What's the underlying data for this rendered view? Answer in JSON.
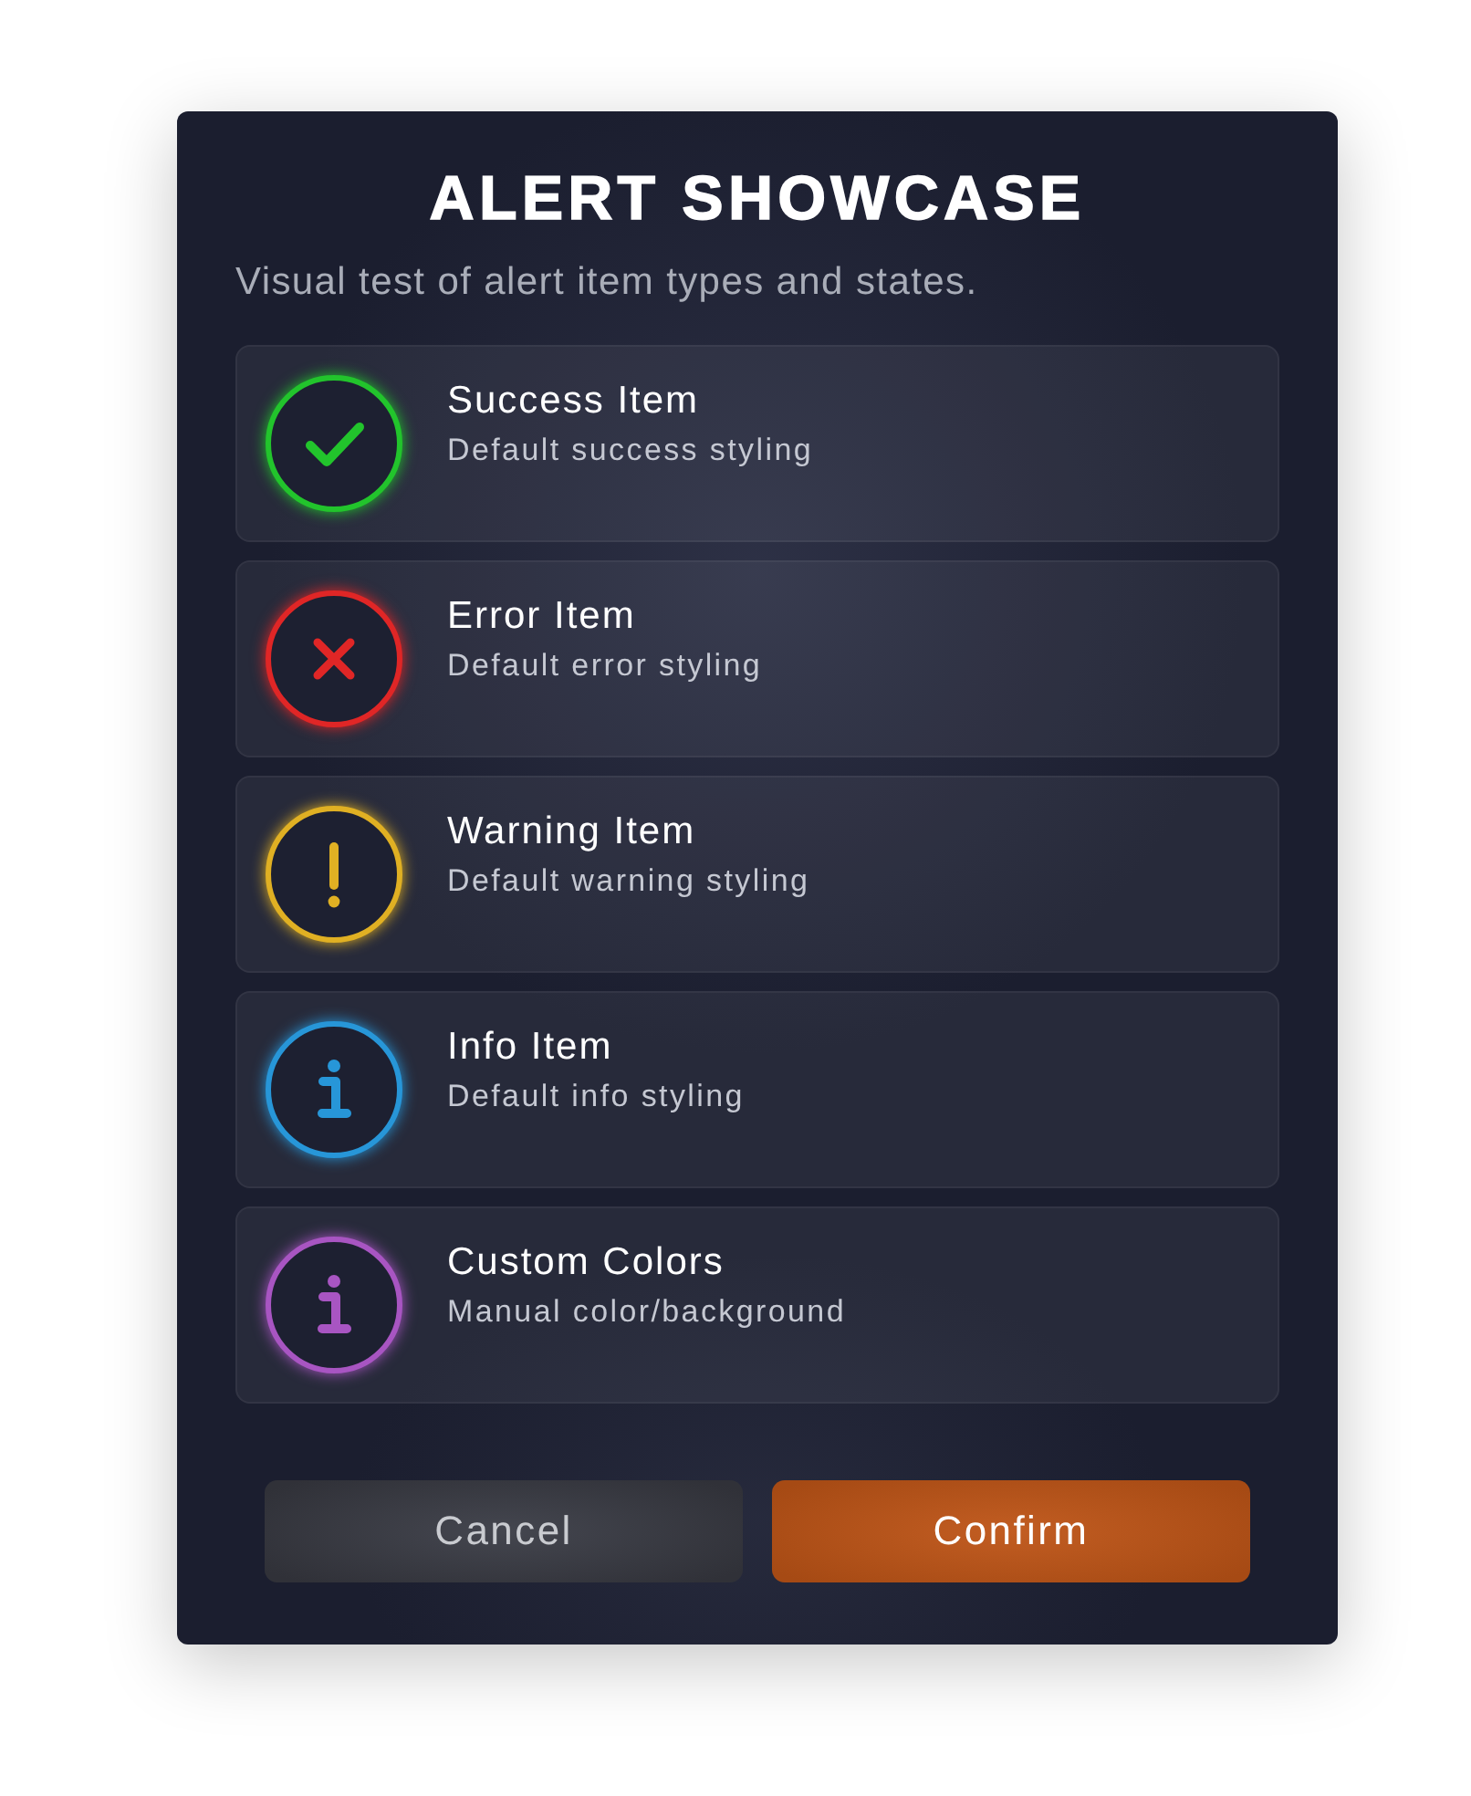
{
  "dialog": {
    "title": "ALERT SHOWCASE",
    "subtitle": "Visual test of alert item types and states."
  },
  "items": [
    {
      "kind": "success",
      "color": "#22c42c",
      "title": "Success Item",
      "description": "Default success styling"
    },
    {
      "kind": "error",
      "color": "#e02626",
      "title": "Error Item",
      "description": "Default error styling"
    },
    {
      "kind": "warning",
      "color": "#e0b023",
      "title": "Warning Item",
      "description": "Default warning styling"
    },
    {
      "kind": "info",
      "color": "#2796d8",
      "title": "Info Item",
      "description": "Default info styling"
    },
    {
      "kind": "info",
      "color": "#a855c2",
      "title": "Custom Colors",
      "description": "Manual color/background"
    }
  ],
  "buttons": [
    {
      "kind": "secondary",
      "label": "Cancel"
    },
    {
      "kind": "primary",
      "label": "Confirm"
    }
  ]
}
